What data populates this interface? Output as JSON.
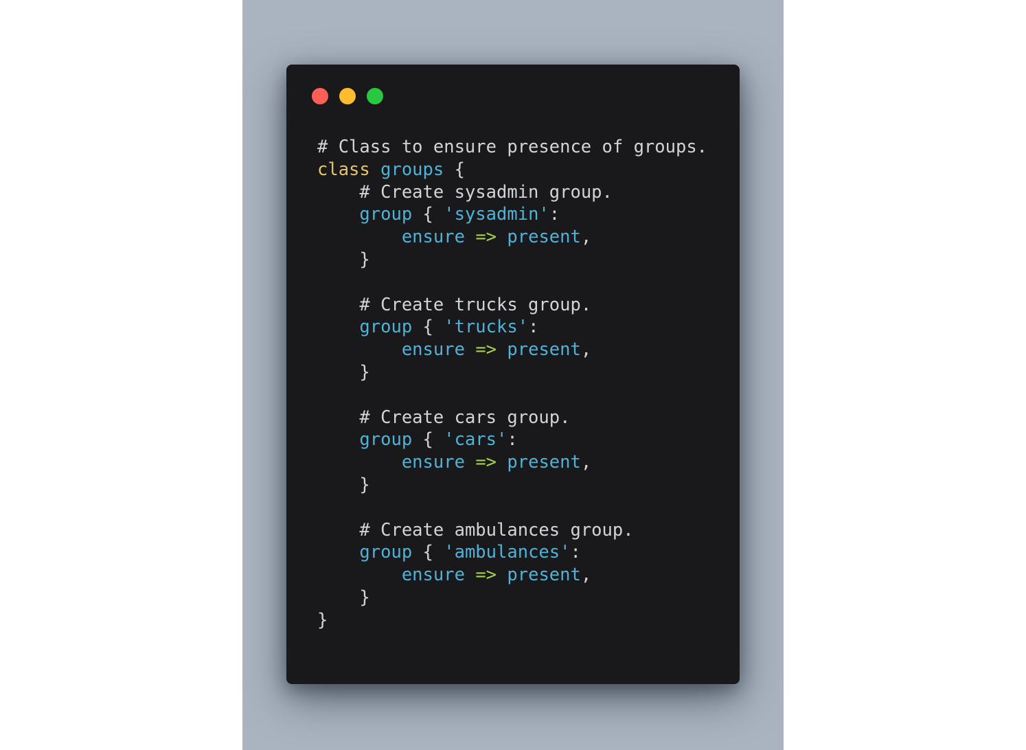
{
  "window": {
    "controls": [
      {
        "name": "close",
        "color": "#ff5f57"
      },
      {
        "name": "minimize",
        "color": "#febc2e"
      },
      {
        "name": "maximize",
        "color": "#28c840"
      }
    ]
  },
  "colors": {
    "backdrop": "#a9b4c0",
    "editor_background": "#19191b",
    "comment": "#d4d4d4",
    "keyword": "#e5c369",
    "identifier": "#4fb3d9",
    "string": "#4fb3d9",
    "operator": "#a6d44a"
  },
  "code": {
    "lines": [
      [
        {
          "t": "comment",
          "v": "# Class to ensure presence of groups."
        }
      ],
      [
        {
          "t": "keyword",
          "v": "class"
        },
        {
          "t": "punct",
          "v": " "
        },
        {
          "t": "name",
          "v": "groups"
        },
        {
          "t": "punct",
          "v": " {"
        }
      ],
      [
        {
          "t": "punct",
          "v": "    "
        },
        {
          "t": "comment",
          "v": "# Create sysadmin group."
        }
      ],
      [
        {
          "t": "punct",
          "v": "    "
        },
        {
          "t": "name",
          "v": "group"
        },
        {
          "t": "punct",
          "v": " { "
        },
        {
          "t": "string",
          "v": "'sysadmin'"
        },
        {
          "t": "punct",
          "v": ":"
        }
      ],
      [
        {
          "t": "punct",
          "v": "        "
        },
        {
          "t": "name",
          "v": "ensure"
        },
        {
          "t": "punct",
          "v": " "
        },
        {
          "t": "arrow",
          "v": "=>"
        },
        {
          "t": "punct",
          "v": " "
        },
        {
          "t": "name",
          "v": "present"
        },
        {
          "t": "punct",
          "v": ","
        }
      ],
      [
        {
          "t": "punct",
          "v": "    }"
        }
      ],
      [],
      [
        {
          "t": "punct",
          "v": "    "
        },
        {
          "t": "comment",
          "v": "# Create trucks group."
        }
      ],
      [
        {
          "t": "punct",
          "v": "    "
        },
        {
          "t": "name",
          "v": "group"
        },
        {
          "t": "punct",
          "v": " { "
        },
        {
          "t": "string",
          "v": "'trucks'"
        },
        {
          "t": "punct",
          "v": ":"
        }
      ],
      [
        {
          "t": "punct",
          "v": "        "
        },
        {
          "t": "name",
          "v": "ensure"
        },
        {
          "t": "punct",
          "v": " "
        },
        {
          "t": "arrow",
          "v": "=>"
        },
        {
          "t": "punct",
          "v": " "
        },
        {
          "t": "name",
          "v": "present"
        },
        {
          "t": "punct",
          "v": ","
        }
      ],
      [
        {
          "t": "punct",
          "v": "    }"
        }
      ],
      [],
      [
        {
          "t": "punct",
          "v": "    "
        },
        {
          "t": "comment",
          "v": "# Create cars group."
        }
      ],
      [
        {
          "t": "punct",
          "v": "    "
        },
        {
          "t": "name",
          "v": "group"
        },
        {
          "t": "punct",
          "v": " { "
        },
        {
          "t": "string",
          "v": "'cars'"
        },
        {
          "t": "punct",
          "v": ":"
        }
      ],
      [
        {
          "t": "punct",
          "v": "        "
        },
        {
          "t": "name",
          "v": "ensure"
        },
        {
          "t": "punct",
          "v": " "
        },
        {
          "t": "arrow",
          "v": "=>"
        },
        {
          "t": "punct",
          "v": " "
        },
        {
          "t": "name",
          "v": "present"
        },
        {
          "t": "punct",
          "v": ","
        }
      ],
      [
        {
          "t": "punct",
          "v": "    }"
        }
      ],
      [],
      [
        {
          "t": "punct",
          "v": "    "
        },
        {
          "t": "comment",
          "v": "# Create ambulances group."
        }
      ],
      [
        {
          "t": "punct",
          "v": "    "
        },
        {
          "t": "name",
          "v": "group"
        },
        {
          "t": "punct",
          "v": " { "
        },
        {
          "t": "string",
          "v": "'ambulances'"
        },
        {
          "t": "punct",
          "v": ":"
        }
      ],
      [
        {
          "t": "punct",
          "v": "        "
        },
        {
          "t": "name",
          "v": "ensure"
        },
        {
          "t": "punct",
          "v": " "
        },
        {
          "t": "arrow",
          "v": "=>"
        },
        {
          "t": "punct",
          "v": " "
        },
        {
          "t": "name",
          "v": "present"
        },
        {
          "t": "punct",
          "v": ","
        }
      ],
      [
        {
          "t": "punct",
          "v": "    }"
        }
      ],
      [
        {
          "t": "punct",
          "v": "}"
        }
      ]
    ]
  }
}
